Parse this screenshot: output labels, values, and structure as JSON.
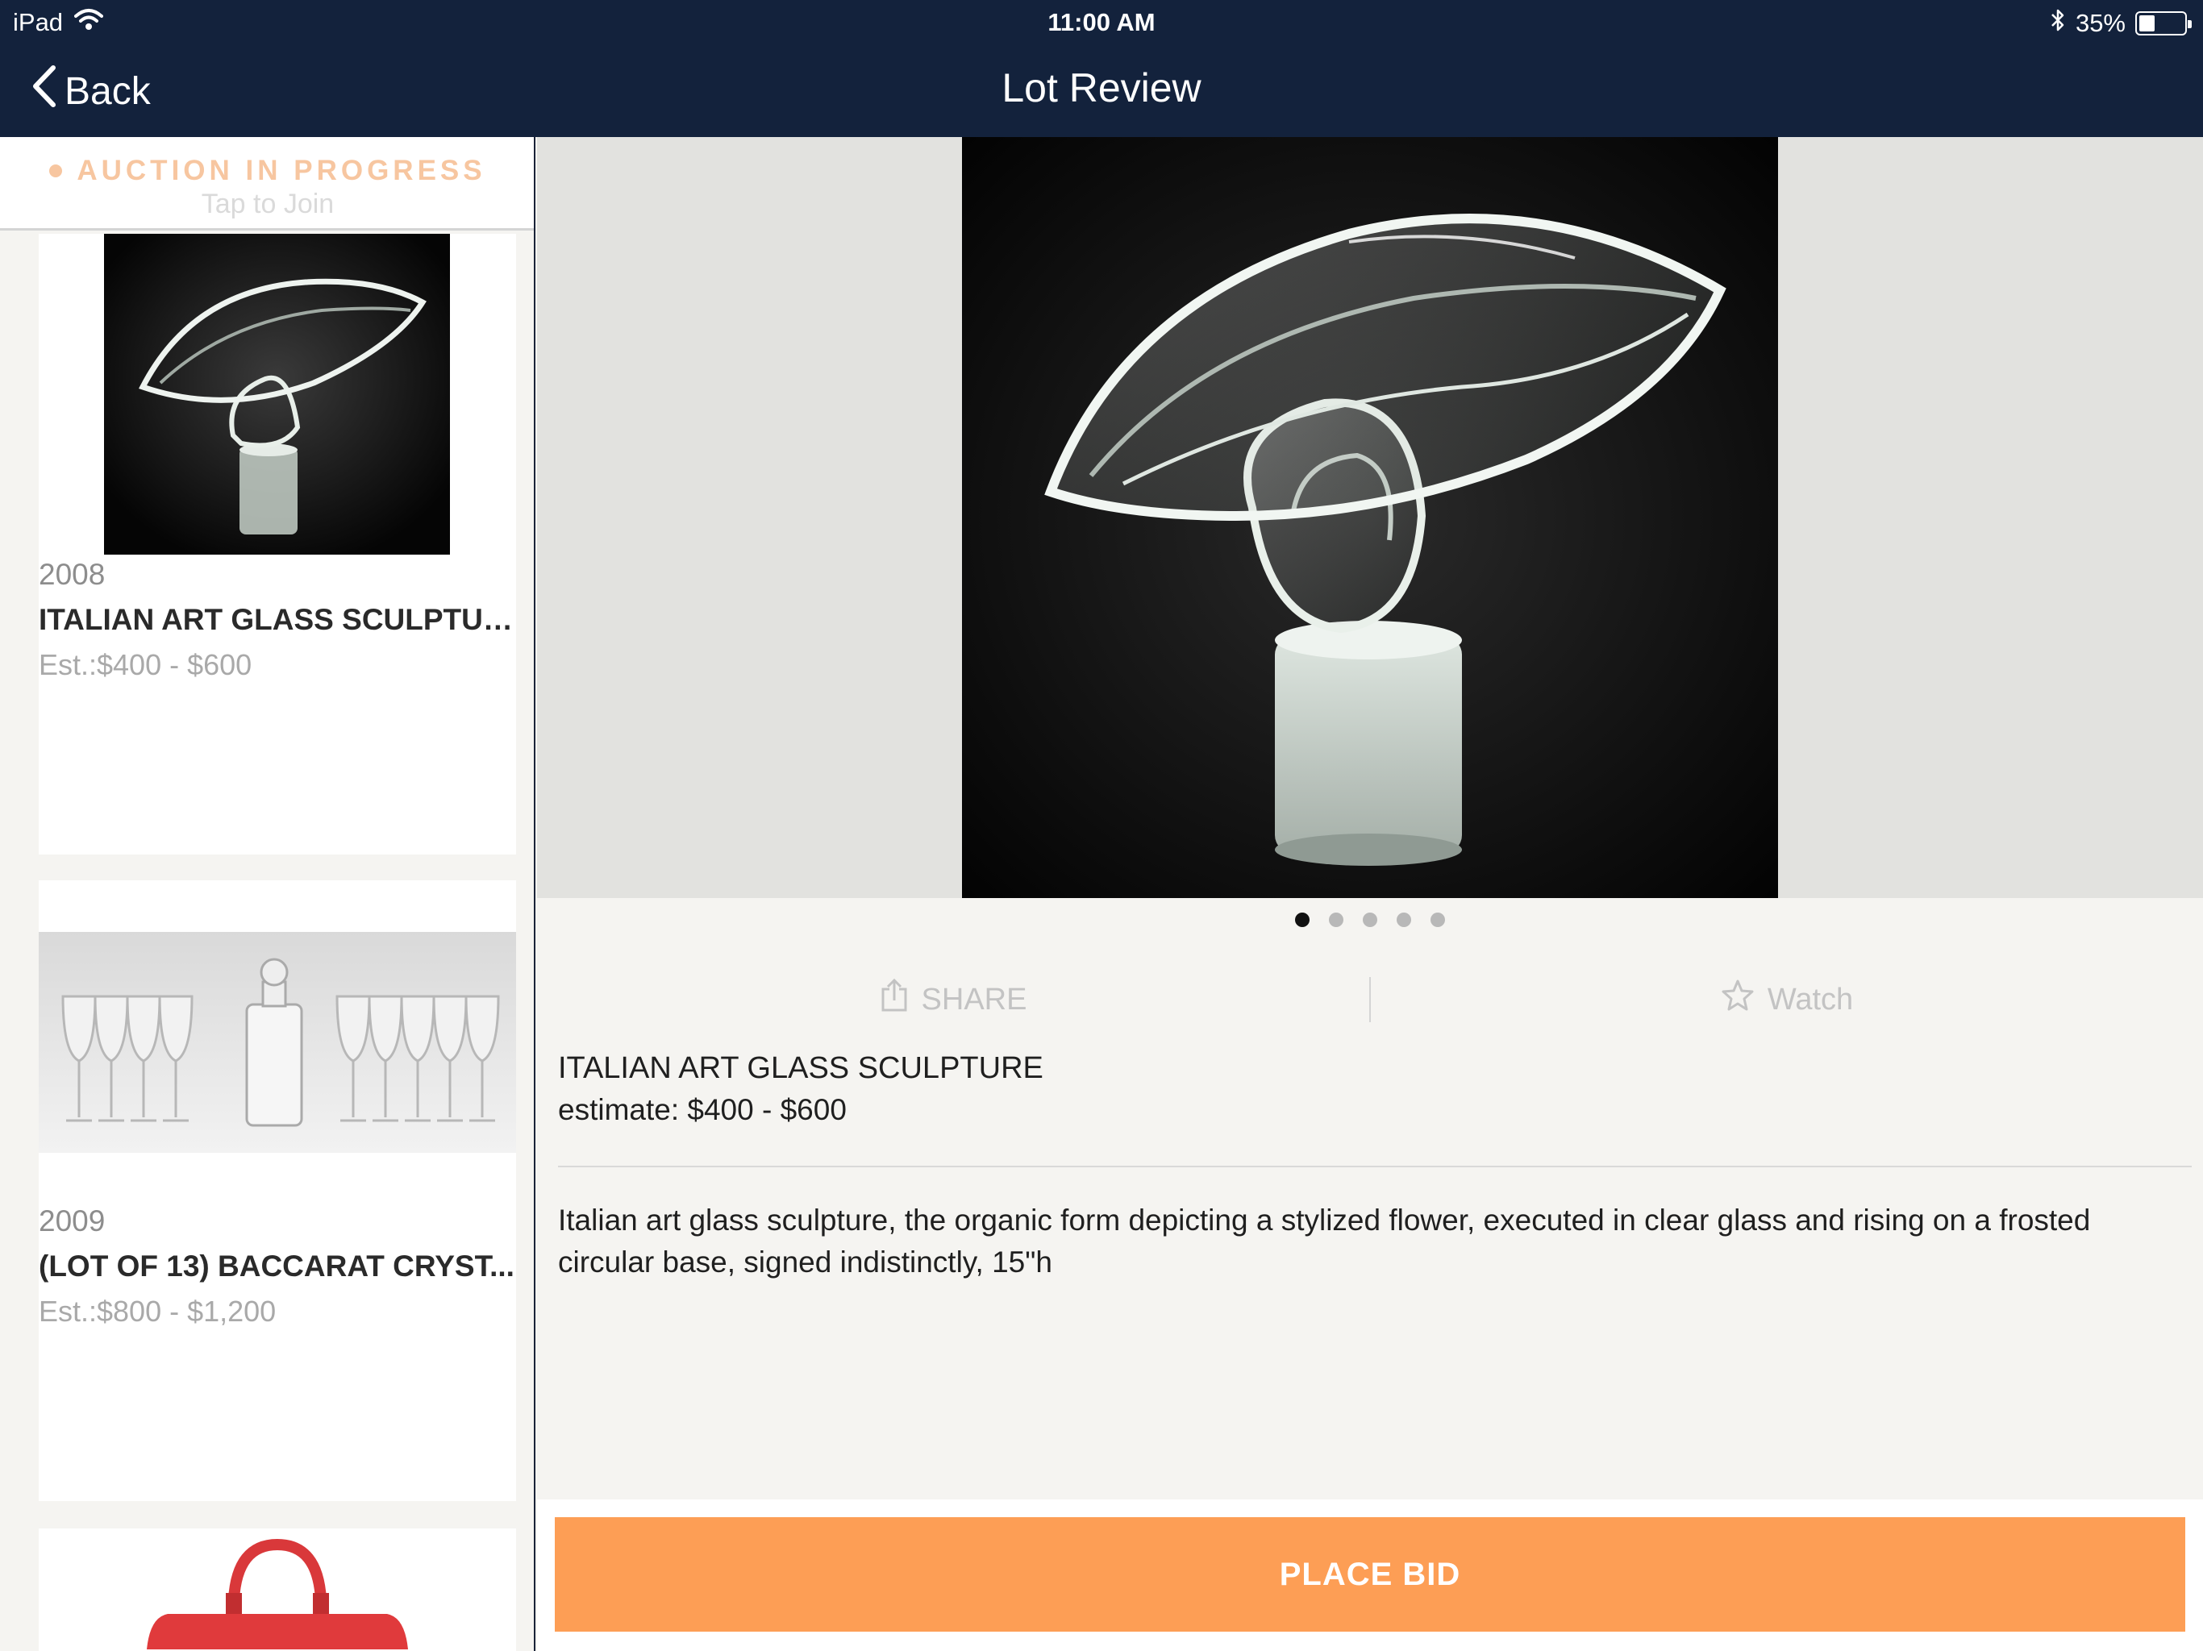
{
  "status_bar": {
    "device": "iPad",
    "time": "11:00 AM",
    "battery": "35%",
    "battery_level": 0.35
  },
  "nav": {
    "back_label": "Back",
    "title": "Lot Review"
  },
  "auction_banner": {
    "title": "AUCTION IN PROGRESS",
    "subtitle": "Tap to Join"
  },
  "lots": [
    {
      "number": "2008",
      "name": "ITALIAN ART GLASS SCULPTURE",
      "estimate": "Est.:$400 - $600"
    },
    {
      "number": "2009",
      "name": "(LOT OF 13) BACCARAT CRYST...",
      "estimate": "Est.:$800 - $1,200"
    }
  ],
  "detail": {
    "share_label": "SHARE",
    "watch_label": "Watch",
    "title": "ITALIAN ART GLASS SCULPTURE",
    "estimate": "estimate: $400 - $600",
    "description": "Italian art glass sculpture, the organic form depicting a stylized flower, executed in clear glass and rising on a frosted circular base, signed indistinctly, 15\"h",
    "image_count": 5,
    "active_image": 1
  },
  "place_bid_label": "PLACE BID",
  "colors": {
    "nav_bg": "#13223c",
    "accent_orange": "#fd9e55",
    "banner_text": "#f7c6a0"
  }
}
